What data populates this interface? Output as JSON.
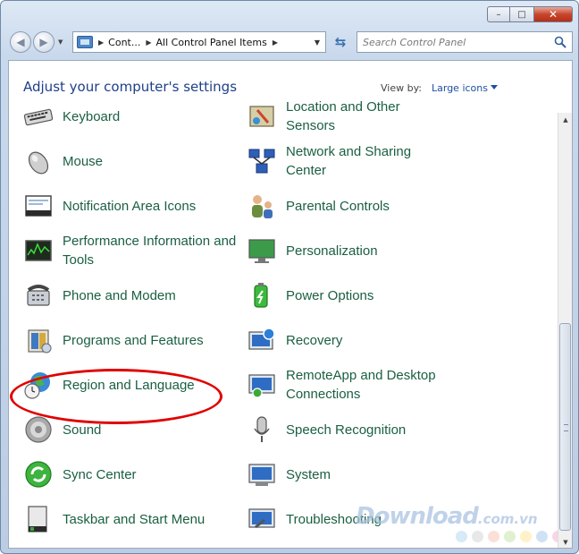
{
  "window": {
    "caption": {
      "minimize": "–",
      "maximize": "□",
      "close": "✕"
    }
  },
  "nav": {
    "address_parts": [
      "Cont...",
      "All Control Panel Items"
    ],
    "search_placeholder": "Search Control Panel"
  },
  "header": {
    "title": "Adjust your computer's settings",
    "view_by_label": "View by:",
    "view_by_value": "Large icons"
  },
  "items_col1": [
    {
      "label": "Keyboard",
      "icon": "keyboard-icon"
    },
    {
      "label": "Mouse",
      "icon": "mouse-icon"
    },
    {
      "label": "Notification Area Icons",
      "icon": "notification-area-icon"
    },
    {
      "label": "Performance Information and Tools",
      "icon": "performance-icon"
    },
    {
      "label": "Phone and Modem",
      "icon": "phone-icon"
    },
    {
      "label": "Programs and Features",
      "icon": "programs-icon"
    },
    {
      "label": "Region and Language",
      "icon": "globe-clock-icon"
    },
    {
      "label": "Sound",
      "icon": "speaker-icon"
    },
    {
      "label": "Sync Center",
      "icon": "sync-icon"
    },
    {
      "label": "Taskbar and Start Menu",
      "icon": "taskbar-icon"
    }
  ],
  "items_col2": [
    {
      "label": "Location and Other Sensors",
      "icon": "sensor-icon"
    },
    {
      "label": "Network and Sharing Center",
      "icon": "network-icon"
    },
    {
      "label": "Parental Controls",
      "icon": "parental-icon"
    },
    {
      "label": "Personalization",
      "icon": "personalization-icon"
    },
    {
      "label": "Power Options",
      "icon": "power-icon"
    },
    {
      "label": "Recovery",
      "icon": "recovery-icon"
    },
    {
      "label": "RemoteApp and Desktop Connections",
      "icon": "remoteapp-icon"
    },
    {
      "label": "Speech Recognition",
      "icon": "microphone-icon"
    },
    {
      "label": "System",
      "icon": "system-icon"
    },
    {
      "label": "Troubleshooting",
      "icon": "troubleshooting-icon"
    }
  ],
  "watermark": {
    "brand": "Download",
    "suffix": ".com.vn"
  },
  "colors": {
    "link_green": "#1a5f42",
    "title_blue": "#1e3f8a",
    "highlight_red": "#e00000",
    "dots": [
      "#d6eaf7",
      "#e8e8e8",
      "#fbe0d8",
      "#e0f0d0",
      "#fff2c8",
      "#cfe2f5",
      "#f8d6e6"
    ]
  }
}
